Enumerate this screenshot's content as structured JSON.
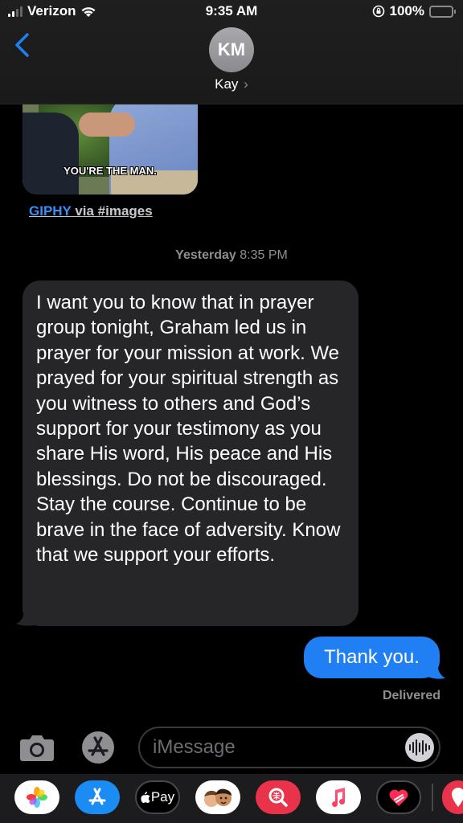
{
  "status": {
    "carrier": "Verizon",
    "time": "9:35 AM",
    "battery": "100%"
  },
  "header": {
    "initials": "KM",
    "name": "Kay",
    "chevron": "›"
  },
  "gif": {
    "caption": "YOU'RE THE MAN.",
    "source_brand": "GIPHY",
    "source_rest": " via #images"
  },
  "timestamp": {
    "day": "Yesterday",
    "time": "8:35 PM"
  },
  "messages": {
    "incoming": "I want you to know that in prayer group tonight, Graham led us in prayer for your mission at work. We prayed for your spiritual strength as you witness to others and God’s support for your testimony as you share His word, His peace and His blessings. Do not be discouraged. Stay the course. Continue to be brave in the face of adversity. Know that we support your efforts.",
    "outgoing": "Thank you.",
    "delivery_status": "Delivered"
  },
  "compose": {
    "placeholder": "iMessage"
  },
  "drawer": {
    "pay_label": "Pay",
    "apps": [
      "photos-icon",
      "app-store-icon",
      "apple-pay-icon",
      "memoji-icon",
      "images-search-icon",
      "music-icon",
      "digital-touch-icon",
      "more-app-icon"
    ]
  },
  "colors": {
    "incoming_bubble": "#262628",
    "outgoing_bubble": "#1f7ff3",
    "link": "#3a8ef6",
    "battery": "#35c759"
  }
}
